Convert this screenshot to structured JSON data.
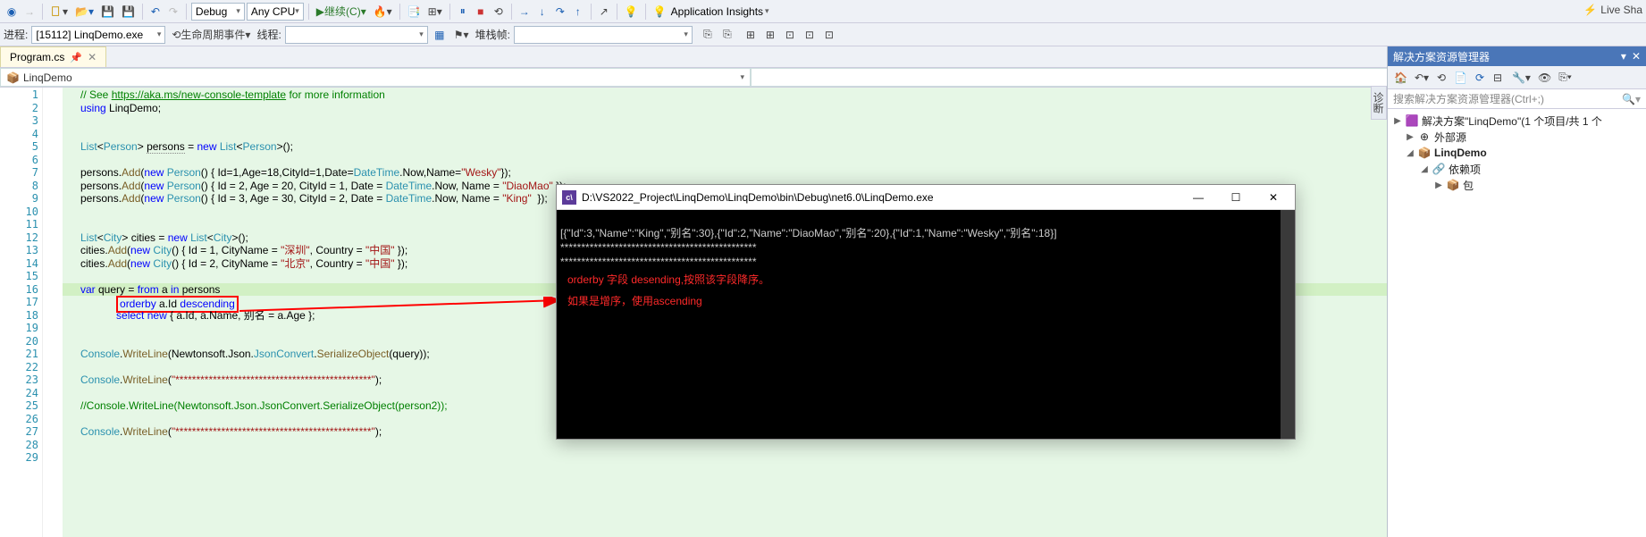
{
  "toolbar": {
    "config": "Debug",
    "platform": "Any CPU",
    "continue_label": "继续(C)",
    "app_insights": "Application Insights",
    "live_share": "Live Sha"
  },
  "toolbar2": {
    "process_label": "进程:",
    "process_value": "[15112] LinqDemo.exe",
    "lifecycle_label": "生命周期事件",
    "thread_label": "线程:",
    "stackframe_label": "堆栈帧:"
  },
  "tabs": {
    "active": "Program.cs"
  },
  "nav": {
    "left": "LinqDemo",
    "mid": "",
    "right": ""
  },
  "code": {
    "lines": [
      {
        "n": 1,
        "html": "<span class='c'>// See </span><span class='link'>https://aka.ms/new-console-template</span><span class='c'> for more information</span>"
      },
      {
        "n": 2,
        "html": "<span class='k'>using</span> <span class='n'>LinqDemo</span>;"
      },
      {
        "n": 3,
        "html": ""
      },
      {
        "n": 4,
        "html": ""
      },
      {
        "n": 5,
        "html": "<span class='t'>List</span>&lt;<span class='t'>Person</span>&gt; <span style='border-bottom:1px dotted #888'>persons</span> = <span class='k'>new</span> <span class='t'>List</span>&lt;<span class='t'>Person</span>&gt;();"
      },
      {
        "n": 6,
        "html": ""
      },
      {
        "n": 7,
        "html": "<span class='n'>persons</span>.<span class='m'>Add</span>(<span class='k'>new</span> <span class='t'>Person</span>() { Id=1,Age=18,CityId=1,Date=<span class='t'>DateTime</span>.Now,Name=<span class='s'>\"Wesky\"</span>});"
      },
      {
        "n": 8,
        "html": "<span class='n'>persons</span>.<span class='m'>Add</span>(<span class='k'>new</span> <span class='t'>Person</span>() { Id = 2, Age = 20, CityId = 1, Date = <span class='t'>DateTime</span>.Now, Name = <span class='s'>\"DiaoMao\"</span> });"
      },
      {
        "n": 9,
        "html": "<span class='n'>persons</span>.<span class='m'>Add</span>(<span class='k'>new</span> <span class='t'>Person</span>() { Id = 3, Age = 30, CityId = 2, Date = <span class='t'>DateTime</span>.Now, Name = <span class='s'>\"King\"</span>  });"
      },
      {
        "n": 10,
        "html": ""
      },
      {
        "n": 11,
        "html": ""
      },
      {
        "n": 12,
        "html": "<span class='t'>List</span>&lt;<span class='t'>City</span>&gt; cities = <span class='k'>new</span> <span class='t'>List</span>&lt;<span class='t'>City</span>&gt;();"
      },
      {
        "n": 13,
        "html": "<span class='n'>cities</span>.<span class='m'>Add</span>(<span class='k'>new</span> <span class='t'>City</span>() { Id = 1, CityName = <span class='s'>\"深圳\"</span>, Country = <span class='s'>\"中国\"</span> });"
      },
      {
        "n": 14,
        "html": "<span class='n'>cities</span>.<span class='m'>Add</span>(<span class='k'>new</span> <span class='t'>City</span>() { Id = 2, CityName = <span class='s'>\"北京\"</span>, Country = <span class='s'>\"中国\"</span> });"
      },
      {
        "n": 15,
        "html": ""
      },
      {
        "n": 16,
        "html": "<span class='k'>var</span> query = <span class='k'>from</span> a <span class='k'>in</span> <span class='n'>persons</span>",
        "hl": true
      },
      {
        "n": 17,
        "html": "            <span class='boxred'><span class='k'>orderby</span> a.Id <span class='k'>descending</span></span>"
      },
      {
        "n": 18,
        "html": "            <span class='k'>select</span> <span class='k'>new</span> { a.Id, a.Name, 别名 = a.Age };"
      },
      {
        "n": 19,
        "html": ""
      },
      {
        "n": 20,
        "html": ""
      },
      {
        "n": 21,
        "html": "<span class='t'>Console</span>.<span class='m'>WriteLine</span>(Newtonsoft.Json.<span class='t'>JsonConvert</span>.<span class='m'>SerializeObject</span>(query));"
      },
      {
        "n": 22,
        "html": ""
      },
      {
        "n": 23,
        "html": "<span class='t'>Console</span>.<span class='m'>WriteLine</span>(<span class='s'>\"***********************************************\"</span>);"
      },
      {
        "n": 24,
        "html": ""
      },
      {
        "n": 25,
        "html": "<span class='c'>//Console.WriteLine(Newtonsoft.Json.JsonConvert.SerializeObject(person2));</span>"
      },
      {
        "n": 26,
        "html": ""
      },
      {
        "n": 27,
        "html": "<span class='t'>Console</span>.<span class='m'>WriteLine</span>(<span class='s'>\"***********************************************\"</span>);"
      },
      {
        "n": 28,
        "html": ""
      },
      {
        "n": 29,
        "html": ""
      }
    ]
  },
  "console": {
    "title": "D:\\VS2022_Project\\LinqDemo\\LinqDemo\\bin\\Debug\\net6.0\\LinqDemo.exe",
    "line1": "[{\"Id\":3,\"Name\":\"King\",\"别名\":30},{\"Id\":2,\"Name\":\"DiaoMao\",\"别名\":20},{\"Id\":1,\"Name\":\"Wesky\",\"别名\":18}]",
    "line2": "***********************************************",
    "line3": "***********************************************",
    "ann1": "orderby 字段 desending,按照该字段降序。",
    "ann2": "如果是增序，使用ascending"
  },
  "solution": {
    "title": "解决方案资源管理器",
    "search_placeholder": "搜索解决方案资源管理器(Ctrl+;)",
    "root": "解决方案\"LinqDemo\"(1 个项目/共 1 个",
    "external": "外部源",
    "project": "LinqDemo",
    "deps": "依赖项",
    "pkg": "包"
  },
  "vlabel": "诊断",
  "icons": {
    "back": "←",
    "fwd": "→",
    "new": "＋",
    "open": "⤴",
    "save": "💾",
    "saveall": "🗎",
    "undo": "↶",
    "redo": "↷",
    "play": "▶",
    "fire": "🔥",
    "stepover": "↷",
    "stepin": "↓",
    "stepout": "↑",
    "stop": "■",
    "pause": "⏸",
    "restart": "⟲"
  }
}
